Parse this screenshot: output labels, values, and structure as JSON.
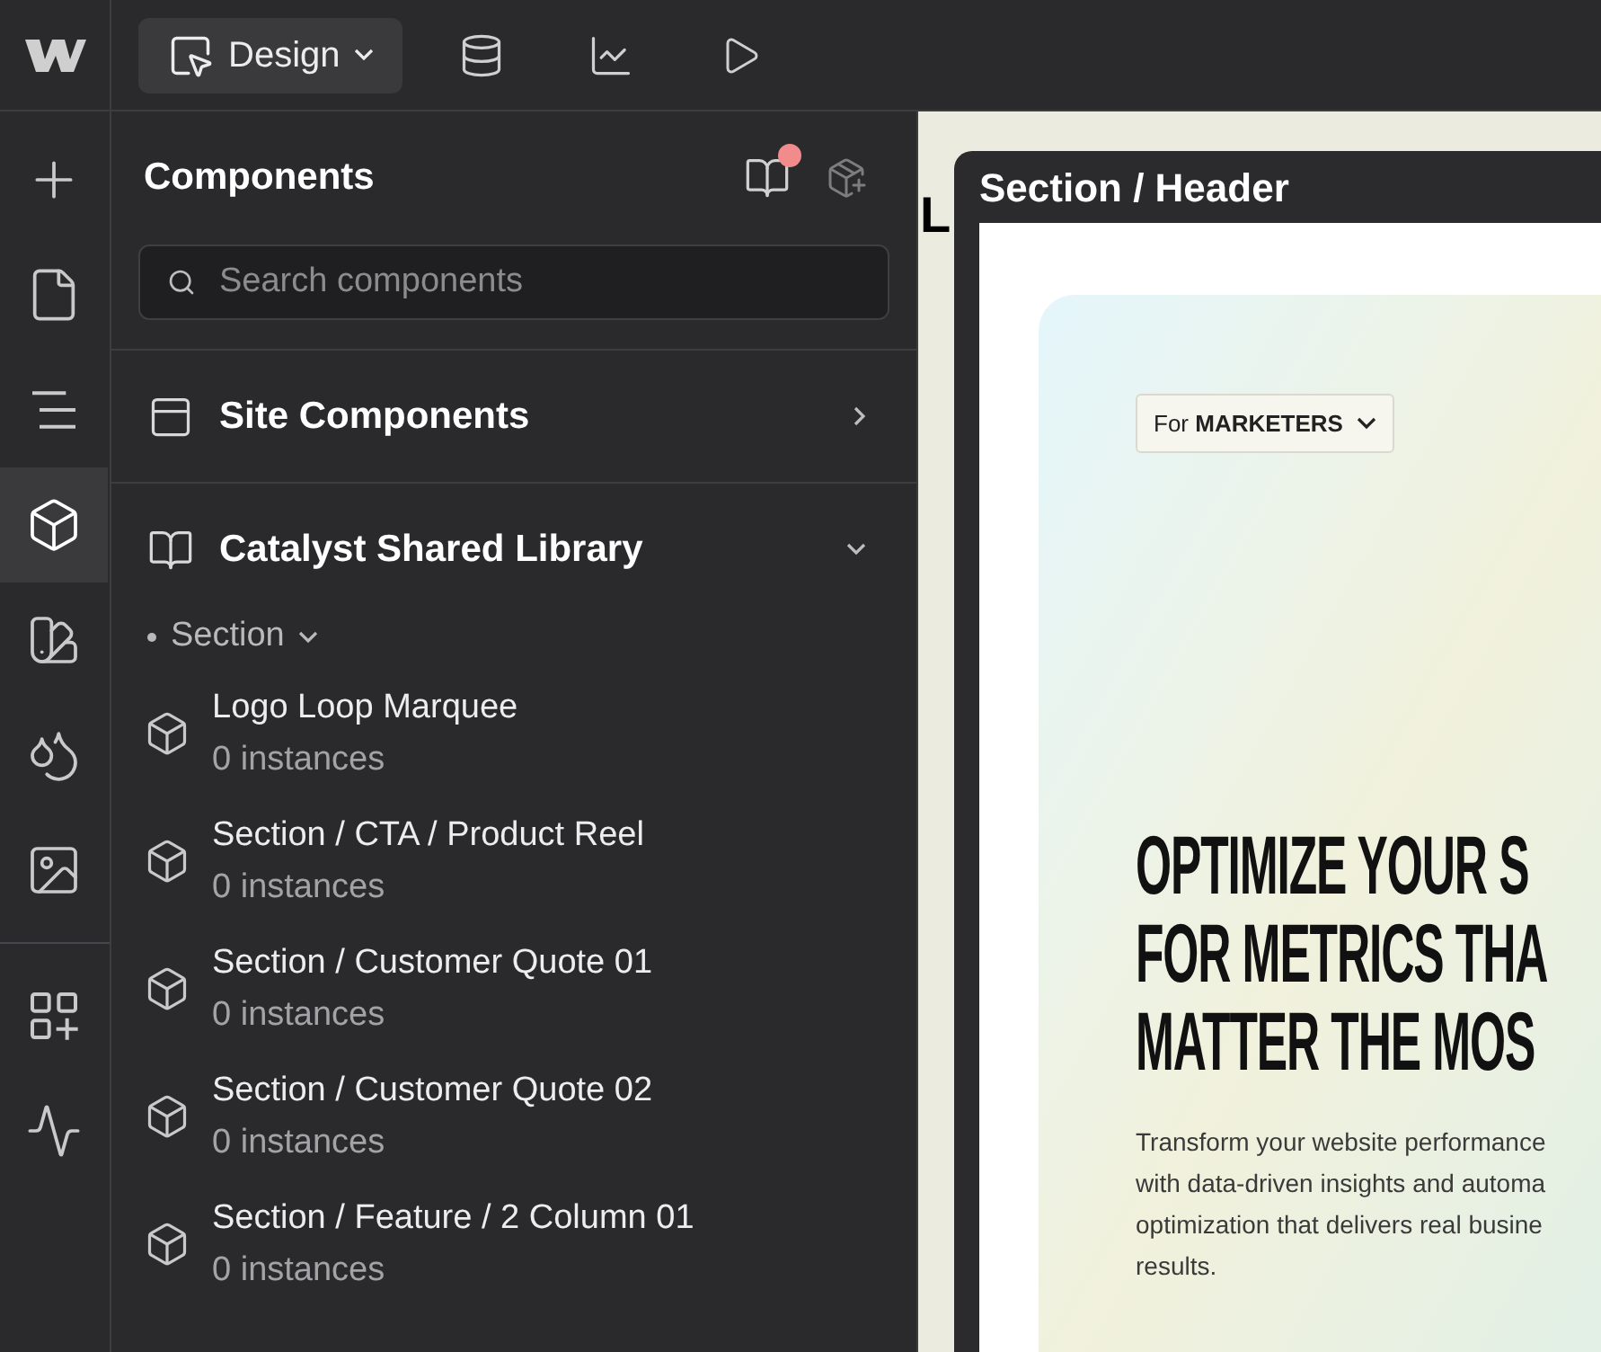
{
  "topbar": {
    "mode_button": "Design"
  },
  "rail_items": [
    {
      "kind": "add",
      "selected": false
    },
    {
      "kind": "pages",
      "selected": false
    },
    {
      "kind": "navigator",
      "selected": false
    },
    {
      "kind": "components",
      "selected": true
    },
    {
      "kind": "styles",
      "selected": false
    },
    {
      "kind": "variables",
      "selected": false
    },
    {
      "kind": "assets",
      "selected": false
    },
    {
      "kind": "apps",
      "selected": false
    },
    {
      "kind": "activity",
      "selected": false
    }
  ],
  "panel": {
    "title": "Components",
    "has_notification": true
  },
  "search": {
    "placeholder": "Search components"
  },
  "sections": [
    {
      "kind": "site",
      "label": "Site Components",
      "expanded": false
    },
    {
      "kind": "library",
      "label": "Catalyst Shared Library",
      "expanded": true
    }
  ],
  "group": {
    "label": "Section",
    "expanded": true
  },
  "components": [
    {
      "name": "Logo Loop Marquee",
      "count": "0 instances"
    },
    {
      "name": "Section / CTA / Product Reel",
      "count": "0 instances"
    },
    {
      "name": "Section / Customer Quote 01",
      "count": "0 instances"
    },
    {
      "name": "Section / Customer Quote 02",
      "count": "0 instances"
    },
    {
      "name": "Section / Feature / 2 Column 01",
      "count": "0 instances"
    }
  ],
  "canvas": {
    "behind_text": "L",
    "frame_title": "Section / Header",
    "dropdown": "For **MARKETERS**",
    "headline": [
      "OPTIMIZE YOUR S",
      "FOR METRICS THA",
      "MATTER THE MOS"
    ],
    "body": [
      "Transform your website performance",
      "with data-driven insights and automa",
      "optimization that delivers real busine",
      "results."
    ]
  }
}
